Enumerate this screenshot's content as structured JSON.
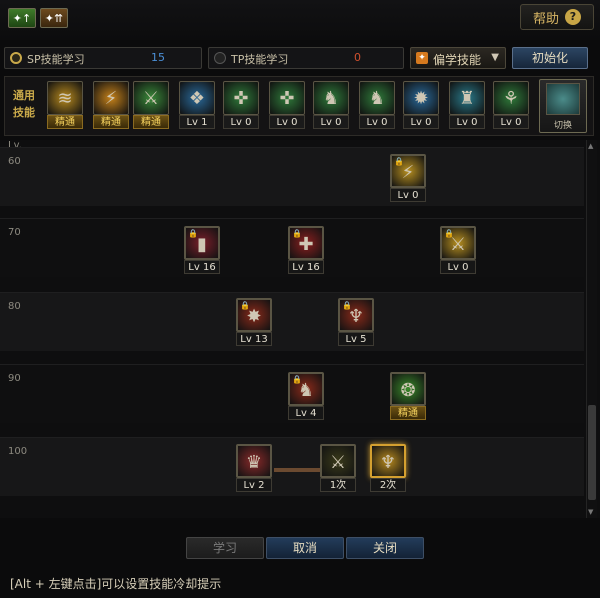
{
  "topbar": {
    "help_label": "帮助",
    "help_icon": "?",
    "mini_buttons": [
      {
        "label": "✦↑"
      },
      {
        "label": "✦⇈"
      }
    ]
  },
  "points": {
    "sp_label": "SP技能学习",
    "sp_value": "15",
    "tp_label": "TP技能学习",
    "tp_value": "0"
  },
  "filter": {
    "selected": "偏学技能",
    "icon": "orange-sword-icon"
  },
  "init_button": "初始化",
  "common": {
    "label": "通用技能",
    "skills": [
      {
        "icon": "claw-slash-icon",
        "level": "精通",
        "color": "#b88a1e",
        "glyph": "≋"
      },
      {
        "icon": "fire-claw-icon",
        "level": "精通",
        "color": "#c6821a",
        "glyph": "⚡"
      },
      {
        "icon": "leaping-warrior-icon",
        "level": "精通",
        "color": "#3a8a3a",
        "glyph": "⚔"
      },
      {
        "icon": "spirit-wings-icon",
        "level": "Lv 1",
        "color": "#2a6a9a",
        "glyph": "❖"
      },
      {
        "icon": "crosshair-icon",
        "level": "Lv 0",
        "color": "#2f7a3a",
        "glyph": "✜"
      },
      {
        "icon": "crosshair-icon-2",
        "level": "Lv 0",
        "color": "#2f7a3a",
        "glyph": "✜"
      },
      {
        "icon": "warrior-stance-icon",
        "level": "Lv 0",
        "color": "#2f7a3a",
        "glyph": "♞"
      },
      {
        "icon": "warrior-stance-icon-2",
        "level": "Lv 0",
        "color": "#2f7a3a",
        "glyph": "♞"
      },
      {
        "icon": "gear-aura-icon",
        "level": "Lv 0",
        "color": "#2a6a9a",
        "glyph": "✹"
      },
      {
        "icon": "armor-icon",
        "level": "Lv 0",
        "color": "#2a7a8a",
        "glyph": "♜"
      },
      {
        "icon": "beast-icon",
        "level": "Lv 0",
        "color": "#2f7a3a",
        "glyph": "⚘"
      }
    ],
    "swap_label": "切换",
    "swap_icon": "swap-skills-icon"
  },
  "tree": {
    "lv_header": "Lv.",
    "levels": [
      "60",
      "70",
      "80",
      "90",
      "100"
    ],
    "skills": [
      {
        "name": "skill-60-a",
        "icon": "golden-slash-icon",
        "level": "Lv 0",
        "color": "#b89020",
        "glyph": "⚡",
        "locked": true
      },
      {
        "name": "skill-70-a",
        "icon": "blue-pillar-icon",
        "level": "Lv 16",
        "color": "#7a1f2a",
        "glyph": "▮",
        "locked": true
      },
      {
        "name": "skill-70-b",
        "icon": "fire-cross-icon",
        "level": "Lv 16",
        "color": "#8a1f1f",
        "glyph": "✚",
        "locked": true
      },
      {
        "name": "skill-70-c",
        "icon": "golden-blade-icon",
        "level": "Lv 0",
        "color": "#b89020",
        "glyph": "⚔",
        "locked": true
      },
      {
        "name": "skill-80-a",
        "icon": "flame-burst-icon",
        "level": "Lv 13",
        "color": "#8a2a1a",
        "glyph": "✸",
        "locked": true
      },
      {
        "name": "skill-80-b",
        "icon": "phoenix-icon",
        "level": "Lv 5",
        "color": "#8a2a1a",
        "glyph": "♆",
        "locked": true
      },
      {
        "name": "skill-90-a",
        "icon": "fire-warrior-icon",
        "level": "Lv 4",
        "color": "#8a2a1a",
        "glyph": "♞",
        "locked": true
      },
      {
        "name": "skill-90-b",
        "icon": "green-spirit-icon",
        "level": "精通",
        "color": "#3a8a2a",
        "glyph": "❂",
        "locked": false
      },
      {
        "name": "skill-100-a",
        "icon": "awakening-icon",
        "level": "Lv 2",
        "color": "#8a2a2a",
        "glyph": "♛",
        "locked": false
      },
      {
        "name": "skill-100-b",
        "icon": "dark-strike-icon",
        "level": "1次",
        "color": "#3a3a1a",
        "glyph": "⚔",
        "locked": false
      },
      {
        "name": "skill-100-c",
        "icon": "golden-phoenix-icon",
        "level": "2次",
        "color": "#b88a1e",
        "glyph": "♆",
        "locked": false
      }
    ]
  },
  "buttons": {
    "learn": "学习",
    "cancel": "取消",
    "close": "关闭"
  },
  "hint": "[Alt + 左键点击]可以设置技能冷却提示",
  "colors": {
    "accent_gold": "#c9a94a",
    "sp_value": "#4b8fd6",
    "tp_value": "#d0502e"
  }
}
